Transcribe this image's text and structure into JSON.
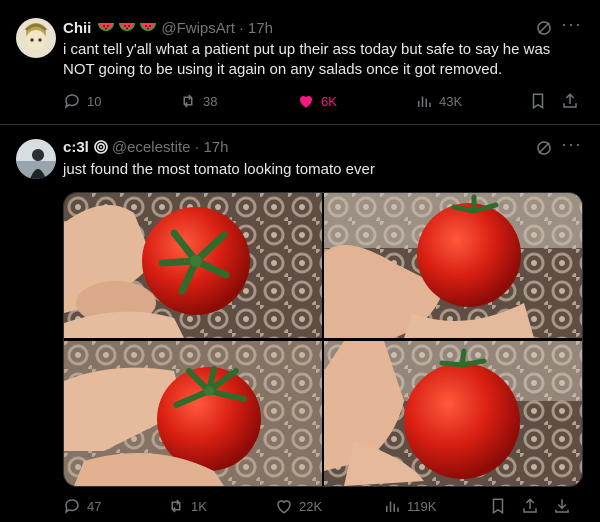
{
  "tweets": [
    {
      "display_name": "Chii",
      "badges": [
        "watermelon-emoji",
        "watermelon-emoji",
        "watermelon-emoji"
      ],
      "handle": "@FwipsArt",
      "dot": "·",
      "time": "17h",
      "text": "i cant tell y'all what a patient put up their ass today but safe to say he was NOT going to be using it again on any salads once it got removed.",
      "stats": {
        "replies": "10",
        "reposts": "38",
        "likes": "6K",
        "views": "43K"
      },
      "liked": true
    },
    {
      "display_name": "c:3l",
      "badges": [
        "spiral-icon"
      ],
      "handle": "@ecelestite",
      "dot": "·",
      "time": "17h",
      "text": "just found the most tomato looking tomato ever",
      "stats": {
        "replies": "47",
        "reposts": "1K",
        "likes": "22K",
        "views": "119K"
      },
      "liked": false,
      "media_count": 4
    }
  ],
  "colors": {
    "background": "#000000",
    "text": "#e7e9ea",
    "muted": "#71767b",
    "like_active": "#f91880",
    "divider": "#2f3336",
    "tomato": "#d92018"
  }
}
